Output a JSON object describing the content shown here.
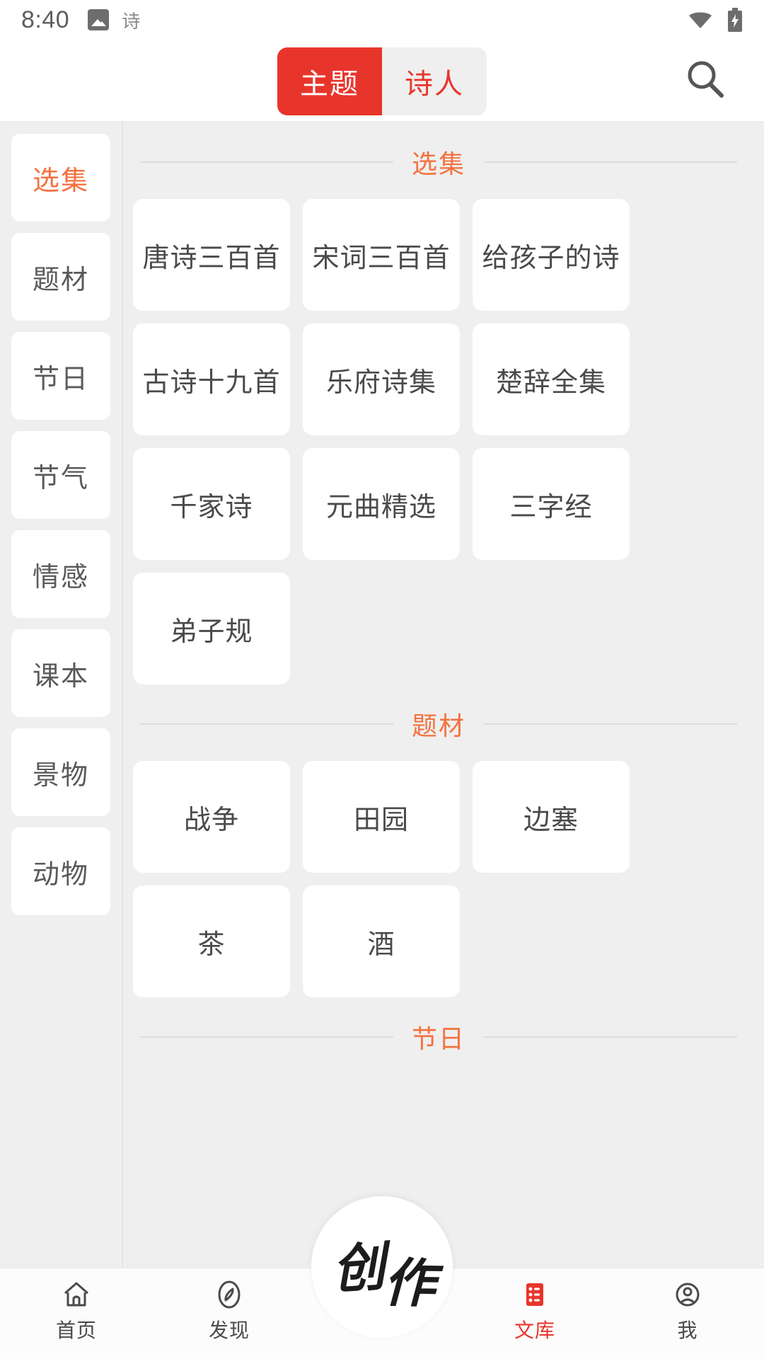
{
  "status_bar": {
    "time": "8:40",
    "notification_icon": "image-icon",
    "notification_label": "诗",
    "wifi_icon": "wifi-icon",
    "battery_icon": "battery-charging-icon"
  },
  "header": {
    "tabs": [
      {
        "label": "主题",
        "active": true
      },
      {
        "label": "诗人",
        "active": false
      }
    ],
    "search_icon": "search-icon",
    "accent_color": "#e8352c"
  },
  "sidebar": {
    "items": [
      {
        "label": "选集",
        "active": true
      },
      {
        "label": "题材",
        "active": false
      },
      {
        "label": "节日",
        "active": false
      },
      {
        "label": "节气",
        "active": false
      },
      {
        "label": "情感",
        "active": false
      },
      {
        "label": "课本",
        "active": false
      },
      {
        "label": "景物",
        "active": false
      },
      {
        "label": "动物",
        "active": false
      }
    ],
    "active_color": "#f4713f"
  },
  "content": {
    "sections": [
      {
        "title": "选集",
        "tiles": [
          "唐诗三百首",
          "宋词三百首",
          "给孩子的诗",
          "古诗十九首",
          "乐府诗集",
          "楚辞全集",
          "千家诗",
          "元曲精选",
          "三字经",
          "弟子规"
        ]
      },
      {
        "title": "题材",
        "tiles": [
          "战争",
          "田园",
          "边塞",
          "茶",
          "酒"
        ]
      },
      {
        "title": "节日",
        "tiles": []
      }
    ],
    "section_color": "#f4713f"
  },
  "fab": {
    "char1": "创",
    "char2": "作"
  },
  "bottom_nav": {
    "items": [
      {
        "label": "首页",
        "icon": "home-icon",
        "active": false
      },
      {
        "label": "发现",
        "icon": "compass-icon",
        "active": false
      },
      {
        "label": "文库",
        "icon": "library-list-icon",
        "active": true
      },
      {
        "label": "我",
        "icon": "person-icon",
        "active": false
      }
    ],
    "active_color": "#e8352c"
  }
}
